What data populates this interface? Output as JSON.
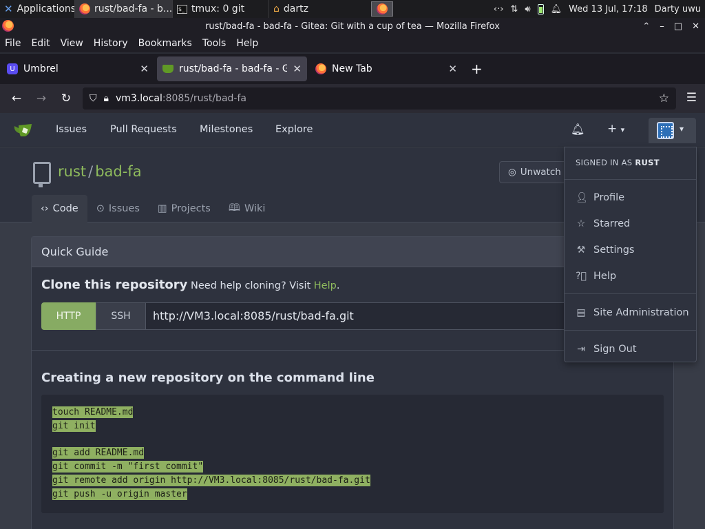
{
  "taskbar": {
    "apps_label": "Applications",
    "windows": [
      {
        "title": "rust/bad-fa - b..."
      },
      {
        "title": "tmux: 0 git"
      },
      {
        "title": "dartz"
      }
    ],
    "clock": "Wed 13 Jul, 17:18",
    "user": "Darty uwu"
  },
  "window": {
    "title": "rust/bad-fa - bad-fa - Gitea: Git with a cup of tea — Mozilla Firefox"
  },
  "menu": [
    "File",
    "Edit",
    "View",
    "History",
    "Bookmarks",
    "Tools",
    "Help"
  ],
  "tabs": [
    {
      "title": "Umbrel"
    },
    {
      "title": "rust/bad-fa - bad-fa - Gitea"
    },
    {
      "title": "New Tab"
    }
  ],
  "url": {
    "host": "vm3.local",
    "rest": ":8085/rust/bad-fa"
  },
  "gitea": {
    "nav": [
      "Issues",
      "Pull Requests",
      "Milestones",
      "Explore"
    ],
    "repo": {
      "owner": "rust",
      "name": "bad-fa",
      "watch_label": "Unwatch"
    },
    "repo_tabs": [
      "Code",
      "Issues",
      "Projects",
      "Wiki"
    ],
    "guide": {
      "title": "Quick Guide",
      "clone_title": "Clone this repository",
      "clone_help": "Need help cloning? Visit",
      "help_link": "Help",
      "http_label": "HTTP",
      "ssh_label": "SSH",
      "clone_url": "http://VM3.local:8085/rust/bad-fa.git",
      "new_repo_title": "Creating a new repository on the command line",
      "commands_a": [
        "touch README.md",
        "git init"
      ],
      "commands_b": [
        "git add README.md",
        "git commit -m \"first commit\"",
        "git remote add origin http://VM3.local:8085/rust/bad-fa.git",
        "git push -u origin master"
      ]
    },
    "user_menu": {
      "signed_in_prefix": "SIGNED IN AS",
      "username": "RUST",
      "items": [
        "Profile",
        "Starred",
        "Settings",
        "Help",
        "Site Administration",
        "Sign Out"
      ]
    }
  }
}
